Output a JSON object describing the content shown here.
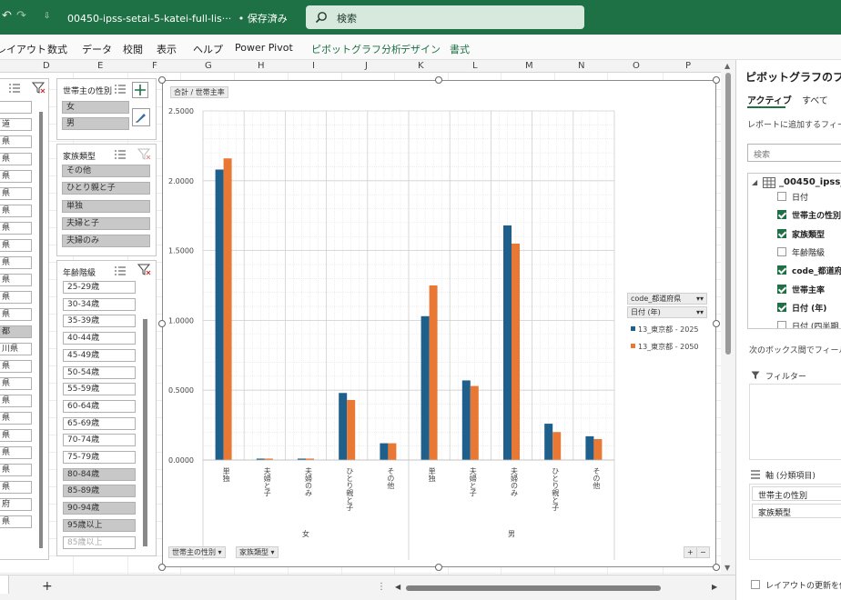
{
  "titlebar": {
    "undo_icon": "undo-icon",
    "redo_icon": "redo-icon",
    "qat_caret": "⇩",
    "file_title": "00450-ipss-setai-5-katei-full-lis···",
    "save_state": "• 保存済み",
    "chevron": "⌄",
    "search_label": "検索",
    "accent": "#1e7145"
  },
  "ribbon": {
    "tabs": [
      "レイアウト",
      "数式",
      "データ",
      "校閲",
      "表示",
      "ヘルプ",
      "Power Pivot",
      "ピボットグラフ分析",
      "デザイン",
      "書式"
    ]
  },
  "columns": [
    "D",
    "E",
    "F",
    "G",
    "H",
    "I",
    "J",
    "K",
    "L",
    "M",
    "N",
    "O",
    "P"
  ],
  "slicer_left": {
    "items": [
      {
        "label": "",
        "state": "un"
      },
      {
        "label": "道",
        "state": "un"
      },
      {
        "label": "県",
        "state": "un"
      },
      {
        "label": "県",
        "state": "un"
      },
      {
        "label": "県",
        "state": "un"
      },
      {
        "label": "県",
        "state": "un"
      },
      {
        "label": "県",
        "state": "un"
      },
      {
        "label": "県",
        "state": "un"
      },
      {
        "label": "県",
        "state": "un"
      },
      {
        "label": "県",
        "state": "un"
      },
      {
        "label": "県",
        "state": "un"
      },
      {
        "label": "県",
        "state": "un"
      },
      {
        "label": "県",
        "state": "un"
      },
      {
        "label": "都",
        "state": "sel"
      },
      {
        "label": "川県",
        "state": "un"
      },
      {
        "label": "県",
        "state": "un"
      },
      {
        "label": "県",
        "state": "un"
      },
      {
        "label": "県",
        "state": "un"
      },
      {
        "label": "県",
        "state": "un"
      },
      {
        "label": "県",
        "state": "un"
      },
      {
        "label": "県",
        "state": "un"
      },
      {
        "label": "県",
        "state": "un"
      },
      {
        "label": "県",
        "state": "un"
      },
      {
        "label": "府",
        "state": "un"
      },
      {
        "label": "県",
        "state": "un"
      }
    ]
  },
  "slicer_sex": {
    "header": "世帯主の性別",
    "items": [
      {
        "label": "女",
        "state": "sel"
      },
      {
        "label": "男",
        "state": "sel"
      }
    ]
  },
  "slicer_family": {
    "header": "家族類型",
    "items": [
      {
        "label": "その他",
        "state": "sel"
      },
      {
        "label": "ひとり親と子",
        "state": "sel"
      },
      {
        "label": "単独",
        "state": "sel"
      },
      {
        "label": "夫婦と子",
        "state": "sel"
      },
      {
        "label": "夫婦のみ",
        "state": "sel"
      }
    ]
  },
  "slicer_age": {
    "header": "年齢階級",
    "items": [
      {
        "label": "25-29歳",
        "state": "un"
      },
      {
        "label": "30-34歳",
        "state": "un"
      },
      {
        "label": "35-39歳",
        "state": "un"
      },
      {
        "label": "40-44歳",
        "state": "un"
      },
      {
        "label": "45-49歳",
        "state": "un"
      },
      {
        "label": "50-54歳",
        "state": "un"
      },
      {
        "label": "55-59歳",
        "state": "un"
      },
      {
        "label": "60-64歳",
        "state": "un"
      },
      {
        "label": "65-69歳",
        "state": "un"
      },
      {
        "label": "70-74歳",
        "state": "un"
      },
      {
        "label": "75-79歳",
        "state": "un"
      },
      {
        "label": "80-84歳",
        "state": "sel"
      },
      {
        "label": "85-89歳",
        "state": "sel"
      },
      {
        "label": "90-94歳",
        "state": "sel"
      },
      {
        "label": "95歳以上",
        "state": "sel"
      },
      {
        "label": "85歳以上",
        "state": "dis"
      }
    ]
  },
  "chart_data": {
    "type": "bar",
    "value_field_button": "合計 / 世帯主率",
    "ylim": [
      0,
      2.5
    ],
    "yticks": [
      "0.0000",
      "0.5000",
      "1.0000",
      "1.5000",
      "2.0000",
      "2.5000"
    ],
    "categories": [
      "単独",
      "夫婦と子",
      "夫婦のみ",
      "ひとり親と子",
      "その他",
      "単独",
      "夫婦と子",
      "夫婦のみ",
      "ひとり親と子",
      "その他"
    ],
    "groups": [
      {
        "label": "女",
        "span": 5
      },
      {
        "label": "男",
        "span": 5
      }
    ],
    "series": [
      {
        "name": "13_東京都 - 2025",
        "color": "#1f5f8b",
        "values": [
          2.08,
          0.01,
          0.01,
          0.48,
          0.12,
          1.03,
          0.57,
          1.68,
          0.26,
          0.17
        ]
      },
      {
        "name": "13_東京都 - 2050",
        "color": "#e87833",
        "values": [
          2.16,
          0.01,
          0.01,
          0.43,
          0.12,
          1.25,
          0.53,
          1.55,
          0.2,
          0.15
        ]
      }
    ],
    "legend_fields": [
      "code_都道府県",
      "日付 (年)"
    ],
    "axis_field_buttons": [
      "世帯主の性別",
      "家族類型"
    ],
    "grid": true
  },
  "pane": {
    "title": "ピボットグラフのフィー",
    "tabs": [
      "アクティブ",
      "すべて"
    ],
    "instruction": "レポートに追加するフィール",
    "search_placeholder": "検索",
    "table_name": "_00450_ipss_",
    "fields": [
      {
        "label": "日付",
        "checked": false,
        "bold": false
      },
      {
        "label": "世帯主の性別",
        "checked": true,
        "bold": true
      },
      {
        "label": "家族類型",
        "checked": true,
        "bold": true
      },
      {
        "label": "年齢階級",
        "checked": false,
        "bold": false
      },
      {
        "label": "code_都道府",
        "checked": true,
        "bold": true
      },
      {
        "label": "世帯主率",
        "checked": true,
        "bold": true
      },
      {
        "label": "日付 (年)",
        "checked": true,
        "bold": true
      },
      {
        "label": "日付 (四半期",
        "checked": false,
        "bold": false
      }
    ],
    "between_boxes": "次のボックス間でフィールド",
    "filter_label": "フィルター",
    "axis_label": "軸 (分類項目)",
    "axis_items": [
      "世帯主の性別",
      "家族類型"
    ],
    "defer_label": "レイアウトの更新を保"
  },
  "statusbar": {
    "add_sheet": "+",
    "dots": "⋮"
  }
}
